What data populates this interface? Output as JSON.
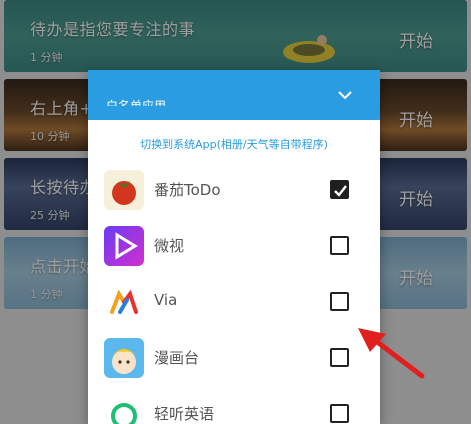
{
  "tasks": [
    {
      "title": "待办是指您要专注的事",
      "duration": "1 分钟",
      "action": "开始"
    },
    {
      "title": "右上角+",
      "duration": "10 分钟",
      "action": "开始"
    },
    {
      "title": "长按待办",
      "duration": "25 分钟",
      "action": "开始"
    },
    {
      "title": "点击开始",
      "duration": "1 分钟",
      "action": "开始"
    }
  ],
  "dialog": {
    "title": "白名单应用",
    "switch_link": "切换到系统App(相册/天气等自带程序)",
    "apps": [
      {
        "name": "番茄ToDo",
        "checked": true,
        "icon": "tomato-icon"
      },
      {
        "name": "微视",
        "checked": false,
        "icon": "weishi-icon"
      },
      {
        "name": "Via",
        "checked": false,
        "icon": "via-icon"
      },
      {
        "name": "漫画台",
        "checked": false,
        "icon": "manhuatai-icon"
      },
      {
        "name": "轻听英语",
        "checked": false,
        "icon": "qingting-icon"
      }
    ]
  },
  "colors": {
    "header_blue": "#2a9de2",
    "arrow_red": "#e21f1f"
  }
}
